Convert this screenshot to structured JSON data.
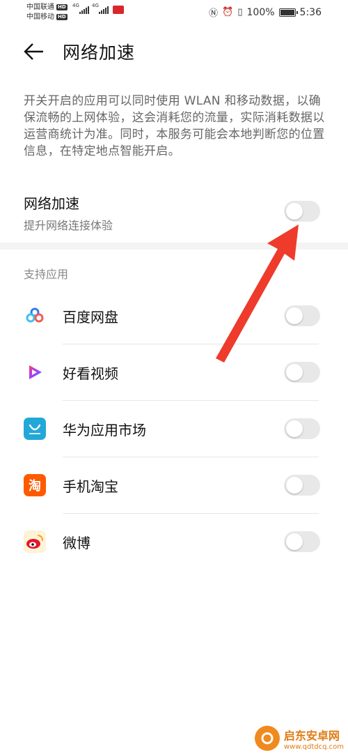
{
  "status_bar": {
    "carrier_1": "中国联通",
    "carrier_2": "中国移动",
    "hd_badge": "HD",
    "network_1": "4G",
    "network_2": "4G",
    "battery_text": "100%",
    "battery_level": 1.0,
    "time": "5:36"
  },
  "header": {
    "title": "网络加速"
  },
  "description": "开关开启的应用可以同时使用 WLAN 和移动数据，以确保流畅的上网体验，这会消耗您的流量，实际消耗数据以运营商统计为准。同时，本服务可能会本地判断您的位置信息，在特定地点智能开启。",
  "main_toggle": {
    "label": "网络加速",
    "sublabel": "提升网络连接体验",
    "on": false
  },
  "section_title": "支持应用",
  "apps": [
    {
      "name": "百度网盘",
      "icon": "baidu-netdisk-icon",
      "on": false
    },
    {
      "name": "好看视频",
      "icon": "haokan-video-icon",
      "on": false
    },
    {
      "name": "华为应用市场",
      "icon": "huawei-appgallery-icon",
      "on": false
    },
    {
      "name": "手机淘宝",
      "icon": "taobao-icon",
      "on": false
    },
    {
      "name": "微博",
      "icon": "weibo-icon",
      "on": false
    }
  ],
  "watermark": {
    "name": "启东安卓网",
    "url": "www.qdtdcq.com"
  },
  "colors": {
    "arrow": "#ee3b2b",
    "toggle_off": "#e8e8e8"
  }
}
